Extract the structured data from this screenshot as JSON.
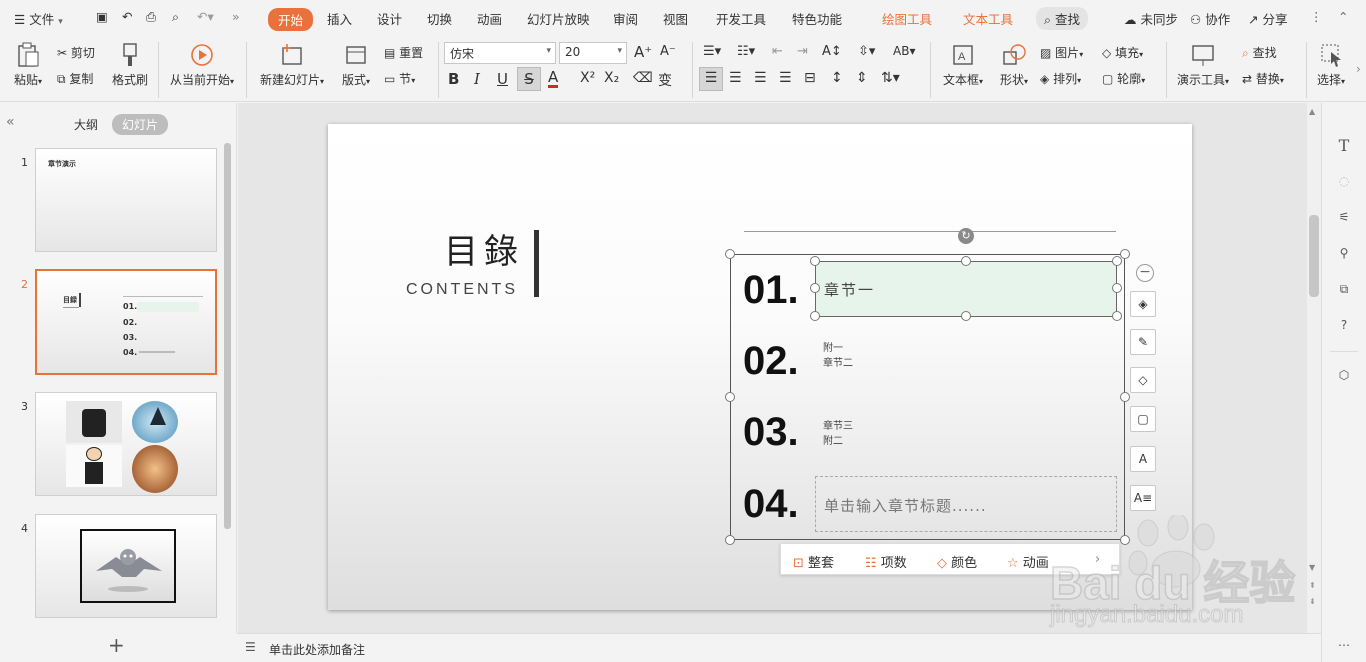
{
  "menubar": {
    "file_label": "文件",
    "tabs": [
      "开始",
      "插入",
      "设计",
      "切换",
      "动画",
      "幻灯片放映",
      "审阅",
      "视图",
      "开发工具",
      "特色功能"
    ],
    "context_tabs": [
      "绘图工具",
      "文本工具"
    ],
    "search_label": "查找",
    "sync_label": "未同步",
    "collab_label": "协作",
    "share_label": "分享"
  },
  "ribbon": {
    "paste": "粘贴",
    "cut": "剪切",
    "copy": "复制",
    "format_painter": "格式刷",
    "from_current": "从当前开始",
    "new_slide": "新建幻灯片",
    "layout": "版式",
    "reset": "重置",
    "section": "节",
    "font_name": "仿宋",
    "font_size": "20",
    "textbox": "文本框",
    "shape": "形状",
    "picture": "图片",
    "fill": "填充",
    "arrange": "排列",
    "outline": "轮廓",
    "present_tools": "演示工具",
    "find": "查找",
    "replace": "替换",
    "select": "选择"
  },
  "left_panel": {
    "outline_tab": "大纲",
    "slides_tab": "幻灯片",
    "slides": [
      {
        "num": "1",
        "title": "章节演示"
      },
      {
        "num": "2",
        "title": "目録"
      },
      {
        "num": "3",
        "title": ""
      },
      {
        "num": "4",
        "title": ""
      }
    ],
    "add_label": "+"
  },
  "slide": {
    "title": "目錄",
    "subtitle": "CONTENTS",
    "items": [
      {
        "num": "01.",
        "text": "章节一"
      },
      {
        "num": "02.",
        "text": "附一\n章节二"
      },
      {
        "num": "03.",
        "text": "章节三\n附二"
      },
      {
        "num": "04.",
        "text": "单击输入章节标题......"
      }
    ]
  },
  "bottom_toolbar": {
    "whole": "整套",
    "items": "项数",
    "color": "颜色",
    "animation": "动画"
  },
  "notes": {
    "placeholder": "单击此处添加备注"
  },
  "watermark": {
    "brand": "Bai du 经验",
    "url": "jingyan.baidu.com"
  },
  "colors": {
    "accent": "#e8713c",
    "selected_fill": "#e6f4ec"
  }
}
